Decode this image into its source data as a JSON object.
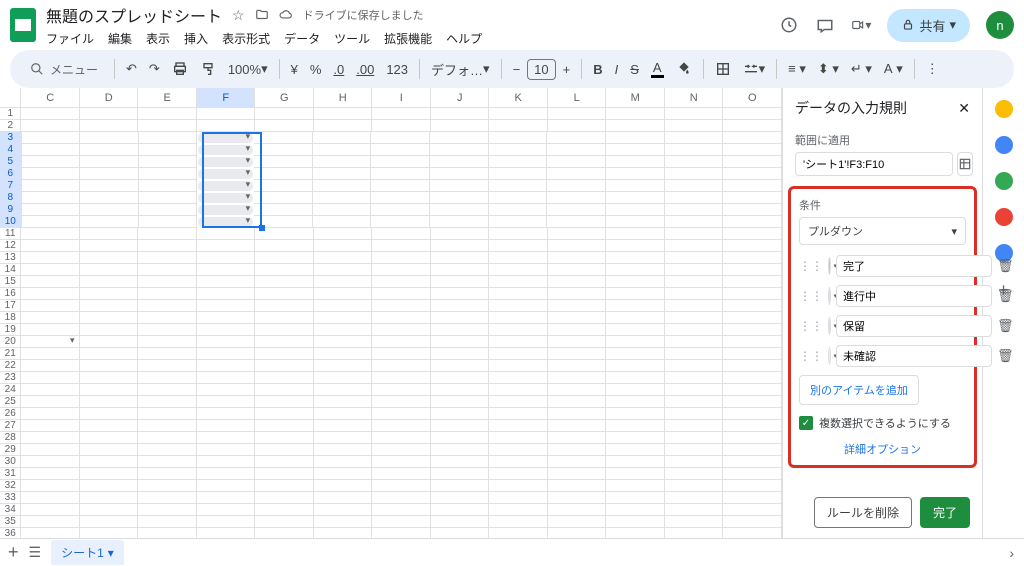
{
  "doc": {
    "title": "無題のスプレッドシート",
    "saved": "ドライブに保存しました"
  },
  "menus": [
    "ファイル",
    "編集",
    "表示",
    "挿入",
    "表示形式",
    "データ",
    "ツール",
    "拡張機能",
    "ヘルプ"
  ],
  "share": {
    "label": "共有"
  },
  "avatar": "n",
  "toolbar": {
    "search": "メニュー",
    "zoom": "100%",
    "digits": ".0",
    "digits2": ".00",
    "one23": "123",
    "font": "デフォ…",
    "size": "10"
  },
  "columns": [
    "C",
    "D",
    "E",
    "F",
    "G",
    "H",
    "I",
    "J",
    "K",
    "L",
    "M",
    "N",
    "O"
  ],
  "rows_count": 36,
  "selected_col": "F",
  "selected_rows": [
    3,
    4,
    5,
    6,
    7,
    8,
    9,
    10
  ],
  "dropdown_cell_row": 20,
  "panel": {
    "title": "データの入力規則",
    "range_label": "範囲に適用",
    "range": "'シート1'!F3:F10",
    "criteria_label": "条件",
    "criteria_value": "プルダウン",
    "items": [
      {
        "color": "#aecbfa",
        "label": "完了"
      },
      {
        "color": "#ceead6",
        "label": "進行中"
      },
      {
        "color": "#fad2cf",
        "label": "保留"
      },
      {
        "color": "#feefc3",
        "label": "未確認"
      }
    ],
    "add_item": "別のアイテムを追加",
    "multi": "複数選択できるようにする",
    "advanced": "詳細オプション",
    "delete_rule": "ルールを削除",
    "done": "完了"
  },
  "sheet_tab": "シート1"
}
